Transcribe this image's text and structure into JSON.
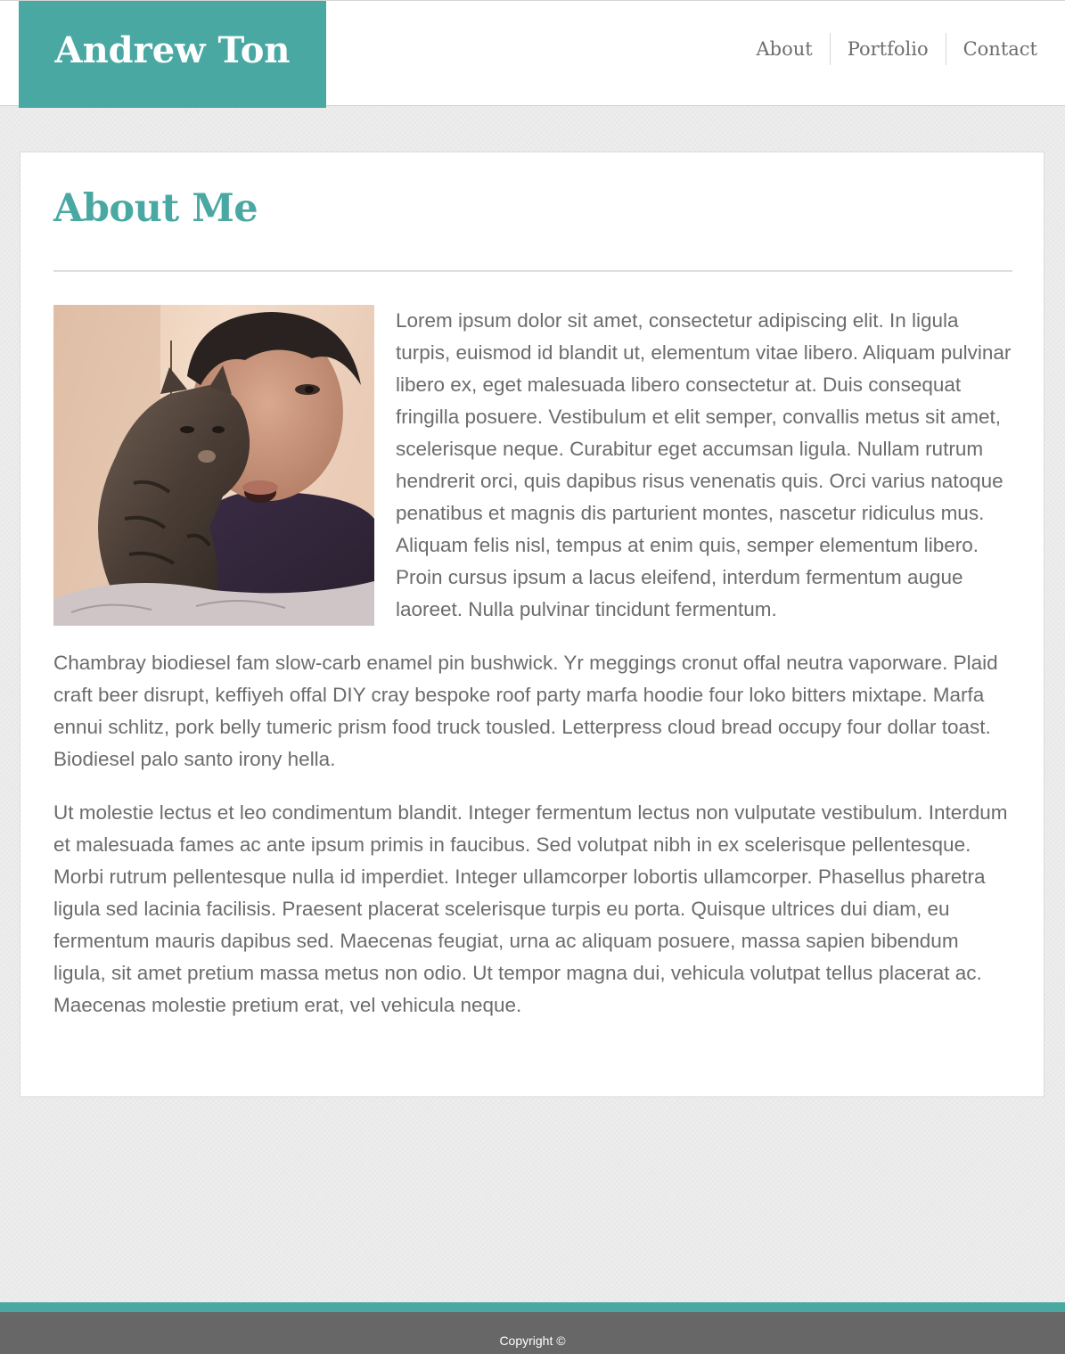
{
  "header": {
    "site_title": "Andrew Ton",
    "nav": [
      {
        "label": "About"
      },
      {
        "label": "Portfolio"
      },
      {
        "label": "Contact"
      }
    ]
  },
  "main": {
    "heading": "About Me",
    "photo_alt": "Andrew Ton with a tabby kitten",
    "paragraphs": [
      "Lorem ipsum dolor sit amet, consectetur adipiscing elit. In ligula turpis, euismod id blandit ut, elementum vitae libero. Aliquam pulvinar libero ex, eget malesuada libero consectetur at. Duis consequat fringilla posuere. Vestibulum et elit semper, convallis metus sit amet, scelerisque neque. Curabitur eget accumsan ligula. Nullam rutrum hendrerit orci, quis dapibus risus venenatis quis. Orci varius natoque penatibus et magnis dis parturient montes, nascetur ridiculus mus. Aliquam felis nisl, tempus at enim quis, semper elementum libero. Proin cursus ipsum a lacus eleifend, interdum fermentum augue laoreet. Nulla pulvinar tincidunt fermentum.",
      "Chambray biodiesel fam slow-carb enamel pin bushwick. Yr meggings cronut offal neutra vaporware. Plaid craft beer disrupt, keffiyeh offal DIY cray bespoke roof party marfa hoodie four loko bitters mixtape. Marfa ennui schlitz, pork belly tumeric prism food truck tousled. Letterpress cloud bread occupy four dollar toast. Biodiesel palo santo irony hella.",
      "Ut molestie lectus et leo condimentum blandit. Integer fermentum lectus non vulputate vestibulum. Interdum et malesuada fames ac ante ipsum primis in faucibus. Sed volutpat nibh in ex scelerisque pellentesque. Morbi rutrum pellentesque nulla id imperdiet. Integer ullamcorper lobortis ullamcorper. Phasellus pharetra ligula sed lacinia facilisis. Praesent placerat scelerisque turpis eu porta. Quisque ultrices dui diam, eu fermentum mauris dapibus sed. Maecenas feugiat, urna ac aliquam posuere, massa sapien bibendum ligula, sit amet pretium massa metus non odio. Ut tempor magna dui, vehicula volutpat tellus placerat ac. Maecenas molestie pretium erat, vel vehicula neque."
    ]
  },
  "footer": {
    "copyright": "Copyright ©"
  },
  "colors": {
    "accent": "#4aa8a3",
    "text": "#6c6c6c",
    "footer_bg": "#676767",
    "page_bg": "#ebebeb"
  }
}
